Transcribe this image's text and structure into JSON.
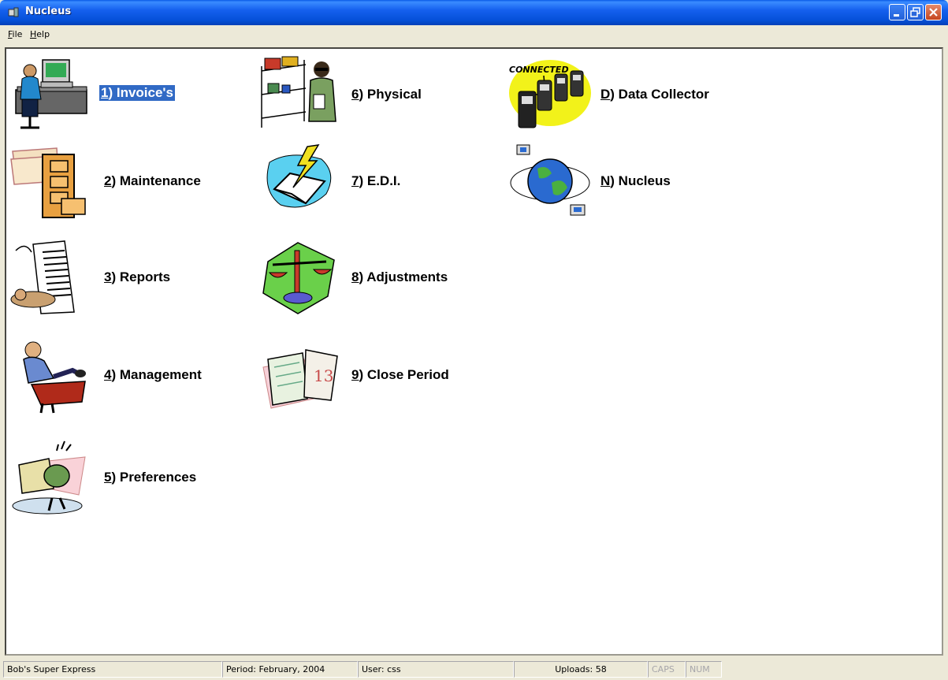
{
  "window": {
    "title": "Nucleus"
  },
  "menu": {
    "file_hotkey": "F",
    "file_rest": "ile",
    "help_hotkey": "H",
    "help_rest": "elp"
  },
  "tiles": [
    {
      "hotkey": "1",
      "rest": ") Invoice's",
      "icon": "computer-user-icon",
      "selected": true
    },
    {
      "hotkey": "2",
      "rest": ") Maintenance",
      "icon": "file-cabinet-icon"
    },
    {
      "hotkey": "3",
      "rest": ") Reports",
      "icon": "report-printout-icon"
    },
    {
      "hotkey": "4",
      "rest": ") Management",
      "icon": "manager-icon"
    },
    {
      "hotkey": "5",
      "rest": ") Preferences",
      "icon": "preferences-icon"
    },
    {
      "hotkey": "6",
      "rest": ") Physical",
      "icon": "inventory-shelves-icon"
    },
    {
      "hotkey": "7",
      "rest": ") E.D.I.",
      "icon": "edi-lightning-icon"
    },
    {
      "hotkey": "8",
      "rest": ") Adjustments",
      "icon": "scales-icon"
    },
    {
      "hotkey": "9",
      "rest": ") Close Period",
      "icon": "calendar-book-icon"
    },
    {
      "hotkey": "D",
      "rest": ") Data Collector",
      "icon": "data-collector-icon",
      "badge": "CONNECTED"
    },
    {
      "hotkey": "N",
      "rest": ") Nucleus",
      "icon": "globe-network-icon"
    }
  ],
  "status": {
    "store": "Bob's Super Express",
    "period": "Period: February, 2004",
    "user": "User: css",
    "uploads": "Uploads: 58",
    "caps": "CAPS",
    "num": "NUM"
  }
}
